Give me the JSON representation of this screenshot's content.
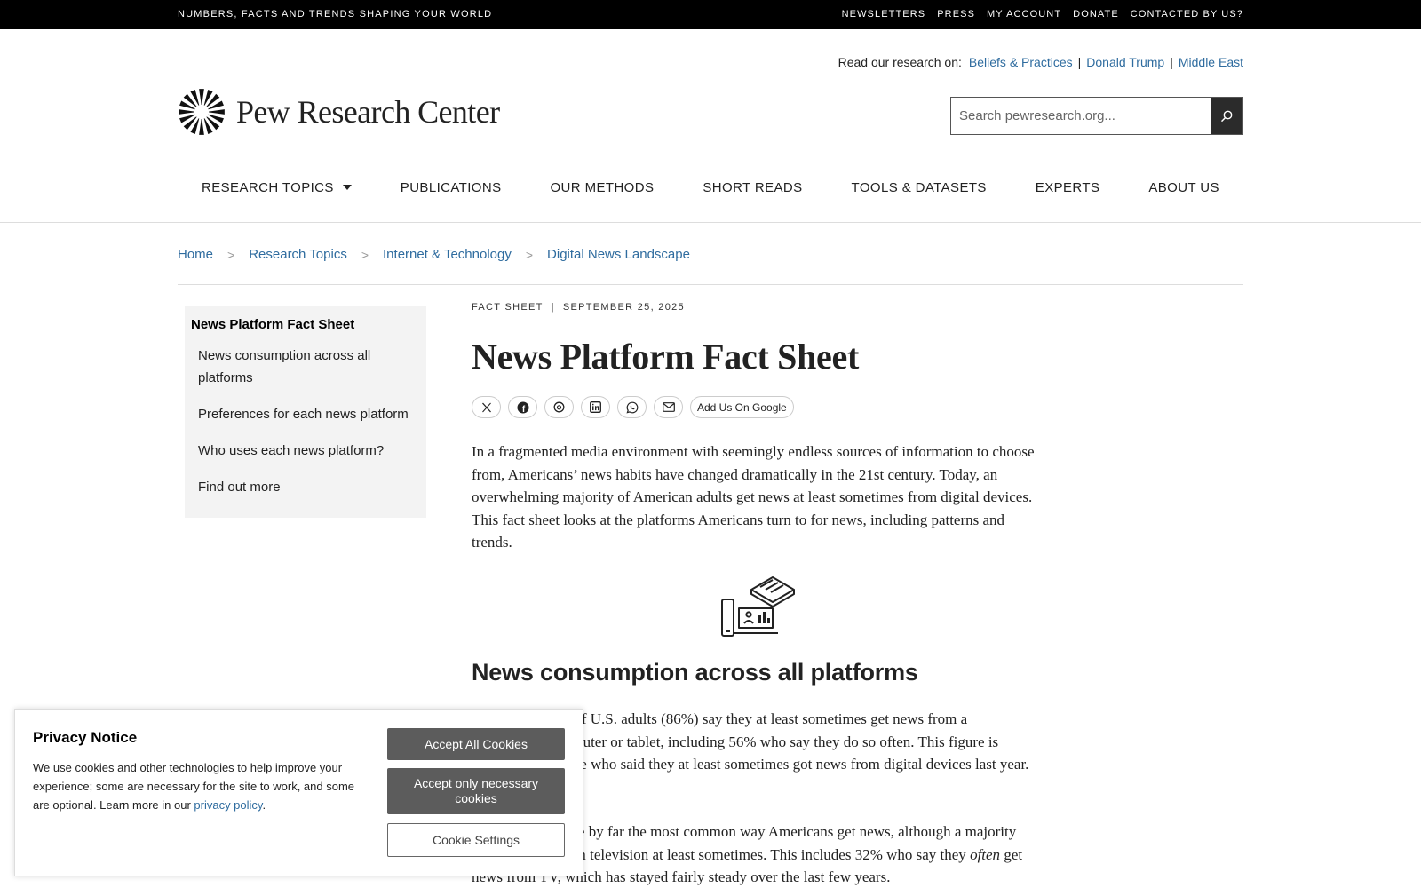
{
  "topbar": {
    "tagline": "NUMBERS, FACTS AND TRENDS SHAPING YOUR WORLD",
    "links": [
      "NEWSLETTERS",
      "PRESS",
      "MY ACCOUNT",
      "DONATE",
      "CONTACTED BY US?"
    ]
  },
  "research_on": {
    "label": "Read our research on:",
    "links": [
      "Beliefs & Practices",
      "Donald Trump",
      "Middle East"
    ]
  },
  "logo": {
    "text": "Pew Research Center"
  },
  "search": {
    "placeholder": "Search pewresearch.org..."
  },
  "nav": {
    "items": [
      "RESEARCH TOPICS",
      "PUBLICATIONS",
      "OUR METHODS",
      "SHORT READS",
      "TOOLS & DATASETS",
      "EXPERTS",
      "ABOUT US"
    ]
  },
  "breadcrumb": {
    "items": [
      "Home",
      "Research Topics",
      "Internet & Technology",
      "Digital News Landscape"
    ],
    "separator": ">"
  },
  "toc": {
    "title": "News Platform Fact Sheet",
    "items": [
      "News consumption across all platforms",
      "Preferences for each news platform",
      "Who uses each news platform?",
      "Find out more"
    ]
  },
  "article": {
    "type": "FACT SHEET",
    "sep": "|",
    "date": "SEPTEMBER 25, 2025",
    "title": "News Platform Fact Sheet",
    "google_button": "Add Us On Google",
    "intro": "In a fragmented media environment with seemingly endless sources of information to choose from, Americans’ news habits have changed dramatically in the 21st century. Today, an overwhelming majority of American adults get news at least sometimes from digital devices. This fact sheet looks at the platforms Americans turn to for news, including patterns and trends.",
    "section_title": "News consumption across all platforms",
    "p1": "A large majority of U.S. adults (86%) say they at least sometimes get news from a smartphone, computer or tablet, including 56% who say they do so often. This figure is similar to the share who said they at least sometimes got news from digital devices last year.",
    "p2_a": "Digital devices are by far the most common way Americans get news, although a majority also get news from television at least sometimes. This includes 32% who say they ",
    "p2_em": "often",
    "p2_b": " get news from TV, which has stayed fairly steady over the last few years."
  },
  "share_icons": [
    "x-icon",
    "facebook-icon",
    "threads-icon",
    "linkedin-icon",
    "whatsapp-icon",
    "email-icon"
  ],
  "cookie": {
    "title": "Privacy Notice",
    "text": "We use cookies and other technologies to help improve your experience; some are necessary for the site to work, and some are optional. Learn more in our ",
    "link": "privacy policy",
    "end": ".",
    "accept_all": "Accept All Cookies",
    "accept_necessary": "Accept only necessary cookies",
    "settings": "Cookie Settings"
  },
  "colors": {
    "link": "#2f6c9f",
    "topbar": "#000000",
    "button": "#5c5c5c"
  }
}
